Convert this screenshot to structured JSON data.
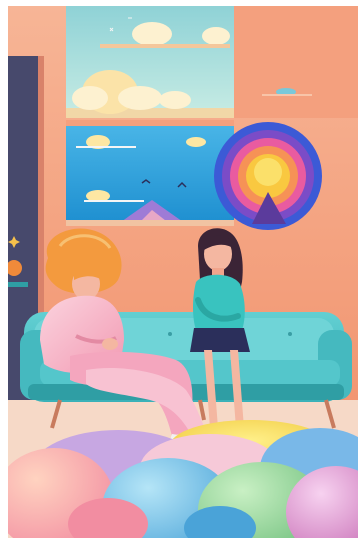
{
  "image": {
    "scene": "illustration",
    "palette": {
      "wall": "#f4a07e",
      "wall_light": "#f7b596",
      "wall_shadow": "#d9826a",
      "sky": "#9ed7d8",
      "sea": "#2aa1dd",
      "sofa": "#53c3c8",
      "sofa_dark": "#2f9ea4",
      "pink": "#f8b7c7",
      "hair_orange": "#f39a3e",
      "teal_top": "#39c3bf",
      "navy": "#2b2f5b",
      "floor_yellow": "#f0c93e",
      "floor_green": "#7bbf7e",
      "floor_pink": "#f28da1",
      "floor_blue": "#79b8e8",
      "floor_lilac": "#c7a7e2",
      "frame": "#e6e6e6"
    }
  }
}
